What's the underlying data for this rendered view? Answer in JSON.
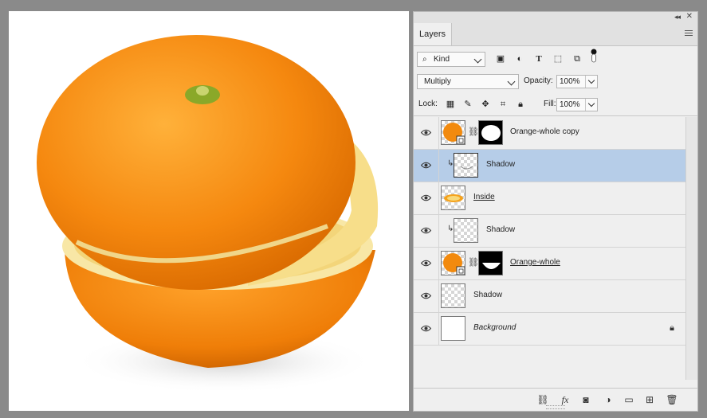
{
  "panel": {
    "collapse_glyph": "◂◂",
    "close_glyph": "✕",
    "tab_label": "Layers",
    "filter": {
      "kind_label": "Kind"
    },
    "blend_mode": "Multiply",
    "opacity_label": "Opacity:",
    "opacity_value": "100%",
    "lock_label": "Lock:",
    "fill_label": "Fill:",
    "fill_value": "100%"
  },
  "layers": [
    {
      "name": "Orange-whole copy",
      "selected": false,
      "has_mask": true,
      "smart": true,
      "clipped": false,
      "style": "normal"
    },
    {
      "name": "Shadow",
      "selected": true,
      "has_mask": false,
      "smart": false,
      "clipped": true,
      "style": "normal"
    },
    {
      "name": "Inside",
      "selected": false,
      "has_mask": false,
      "smart": false,
      "clipped": false,
      "style": "underline"
    },
    {
      "name": "Shadow",
      "selected": false,
      "has_mask": false,
      "smart": false,
      "clipped": true,
      "style": "normal"
    },
    {
      "name": "Orange-whole ",
      "selected": false,
      "has_mask": true,
      "smart": true,
      "clipped": false,
      "style": "underline"
    },
    {
      "name": "Shadow",
      "selected": false,
      "has_mask": false,
      "smart": false,
      "clipped": false,
      "style": "normal"
    },
    {
      "name": "Background",
      "selected": false,
      "has_mask": false,
      "smart": false,
      "clipped": false,
      "style": "italic",
      "locked": true
    }
  ],
  "colors": {
    "accent_selected": "#b6cde8",
    "orange": "#f28a0e"
  }
}
